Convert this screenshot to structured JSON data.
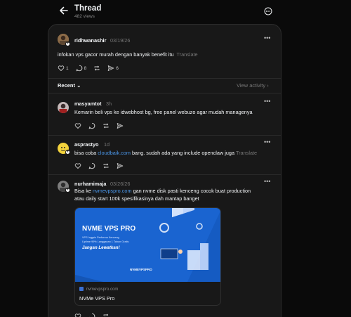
{
  "header": {
    "title": "Thread",
    "views": "482 views"
  },
  "root_post": {
    "username": "ridhwanashir",
    "date": "03/19/26",
    "text": "infokan vps gacor murah dengan banyak benefit itu",
    "translate": "Translate",
    "likes": "1",
    "replies": "8",
    "shares": "6"
  },
  "sort": {
    "label": "Recent",
    "view_activity": "View activity"
  },
  "replies": [
    {
      "username": "masyamtot",
      "time": "3h",
      "text": "Kemarin beli vps ke idwebhost bg, free panel webuzo agar mudah managenya"
    },
    {
      "username": "asprastyo",
      "time": "1d",
      "text_before": "bisa coba",
      "link": "cloudbaik.com",
      "text_after": "bang. sudah ada yang include openclaw juga",
      "translate": "Translate"
    },
    {
      "username": "nurhamimaja",
      "time": "03/26/26",
      "text_before": "Bisa ke",
      "link": "nvmevpspro.com",
      "text_after": "gan nvme disk pasti kenceng cocok buat production",
      "text_line2": "atau daily start 100k spesifikasinya dah mantap banget"
    }
  ],
  "link_preview": {
    "banner_title": "NVME VPS PRO",
    "banner_line1": "VPS Inggris Performa Kencang",
    "banner_line2": "Uptime 99% Langganan 1 Tahun Gratis",
    "banner_cta": "Jangan Lewatkan!",
    "banner_logo": "NVMEVPSPRO",
    "domain": "nvmevpspro.com",
    "site_name": "NVMe VPS Pro"
  },
  "colors": {
    "background": "#0a0a0a",
    "card": "#181818",
    "link": "#4a96e8",
    "banner": "#1a64d0"
  }
}
